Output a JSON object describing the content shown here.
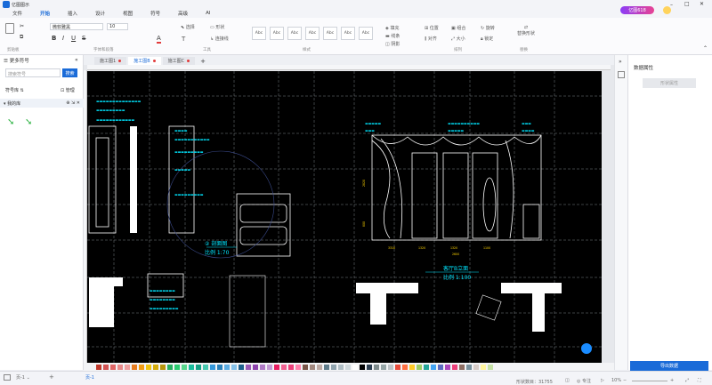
{
  "app": {
    "title": "亿图图示"
  },
  "topright": {
    "badge": "亿图618",
    "publish": "发布",
    "share": "分享",
    "select": "选项",
    "help": "帮助"
  },
  "menu": [
    "文件",
    "开始",
    "插入",
    "设计",
    "视图",
    "符号",
    "高级",
    "AI"
  ],
  "menu_active_index": 1,
  "ribbon": {
    "font_name": "微软雅黑",
    "font_size": "10",
    "select_label": "选择",
    "shape_label": "形状",
    "connector_label": "连接线",
    "style_labels": [
      "Abc",
      "Abc",
      "Abc",
      "Abc",
      "Abc",
      "Abc",
      "Abc"
    ],
    "fill": "填充",
    "line": "线条",
    "shadow": "阴影",
    "position": "位置",
    "align": "对齐",
    "size": "大小",
    "group": "组合",
    "rotate": "旋转",
    "lock": "锁定",
    "replace": "替换形状",
    "groups": {
      "clipboard": "剪贴板",
      "font": "字体和段落",
      "tools": "工具",
      "style": "样式",
      "arrange": "排列",
      "replace": "替换"
    }
  },
  "left_panel": {
    "header": "更多符号",
    "search_placeholder": "搜索符号",
    "search_btn": "搜索",
    "library_label": "符号库",
    "manage": "管理",
    "my_library": "我的库"
  },
  "tabs": [
    {
      "label": "施工图1",
      "modified": true
    },
    {
      "label": "施工图B",
      "modified": true
    },
    {
      "label": "施工图C",
      "modified": true
    }
  ],
  "tab_active_index": 1,
  "right_panel": {
    "title": "数据属性",
    "shape_btn": "形状属性",
    "export_btn": "导出数据"
  },
  "drawing": {
    "label_section": "② 剖面图",
    "scale_section": "比例 1:70",
    "label_elevation": "客厅B立面",
    "scale_elevation": "比例 1:100",
    "dims": [
      "2820",
      "800",
      "3310",
      "1320",
      "1320",
      "1100",
      "2600"
    ]
  },
  "palette": [
    "#c0392b",
    "#d35454",
    "#e06666",
    "#e88a8a",
    "#f0a0a0",
    "#e67e22",
    "#f39c12",
    "#f1c40f",
    "#d4ac0d",
    "#b7950b",
    "#27ae60",
    "#2ecc71",
    "#58d68d",
    "#1abc9c",
    "#16a085",
    "#48c9b0",
    "#3498db",
    "#2980b9",
    "#5dade2",
    "#85c1e9",
    "#1f618d",
    "#9b59b6",
    "#8e44ad",
    "#af7ac5",
    "#c39bd3",
    "#e91e63",
    "#f06292",
    "#ec407a",
    "#ff80ab",
    "#795548",
    "#a1887f",
    "#bcaaa4",
    "#607d8b",
    "#90a4ae",
    "#b0bec5",
    "#cfd8dc",
    "#ffffff",
    "#000000",
    "#2c3e50",
    "#7f8c8d",
    "#95a5a6",
    "#bdc3c7",
    "#e74c3c",
    "#ff7043",
    "#ffca28",
    "#9ccc65",
    "#26a69a",
    "#42a5f5",
    "#5c6bc0",
    "#ab47bc",
    "#ec407a",
    "#8d6e63",
    "#78909c",
    "#d7ccc8",
    "#fff59d",
    "#c5e1a5"
  ],
  "status": {
    "page_tab": "页-1",
    "page_sel": "页-1",
    "shape_count": "形状数目：31755",
    "focus": "专注",
    "zoom": "10%"
  }
}
